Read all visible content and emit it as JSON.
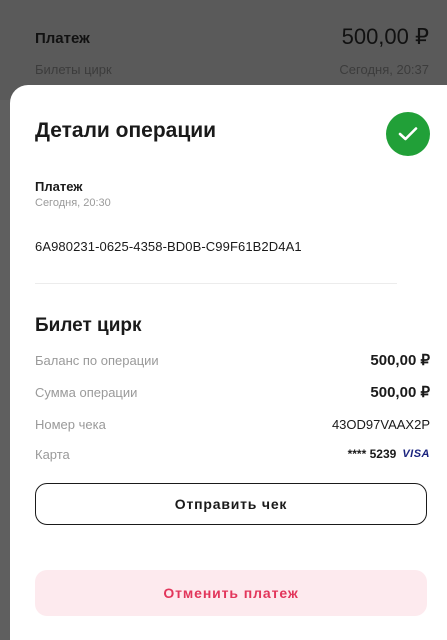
{
  "background": {
    "title": "Платеж",
    "amount": "500,00 ₽",
    "subtitle": "Билеты цирк",
    "time": "Сегодня, 20:37"
  },
  "sheet": {
    "title": "Детали операции",
    "status_icon": "check-icon",
    "operation": {
      "type": "Платеж",
      "time": "Сегодня, 20:30",
      "id": "6A980231-0625-4358-BD0B-C99F61B2D4A1"
    },
    "section_title": "Билет цирк",
    "details": [
      {
        "label": "Баланс по операции",
        "value": "500,00 ₽"
      },
      {
        "label": "Сумма операции",
        "value": "500,00 ₽"
      },
      {
        "label": "Номер чека",
        "value": "43OD97VAAX2P"
      },
      {
        "label": "Карта",
        "value": "**** 5239",
        "brand": "VISA"
      }
    ],
    "send_receipt_label": "Отправить чек",
    "cancel_payment_label": "Отменить платеж"
  },
  "colors": {
    "success": "#21a038",
    "danger": "#e2365b",
    "danger_bg": "#fdeaee"
  }
}
